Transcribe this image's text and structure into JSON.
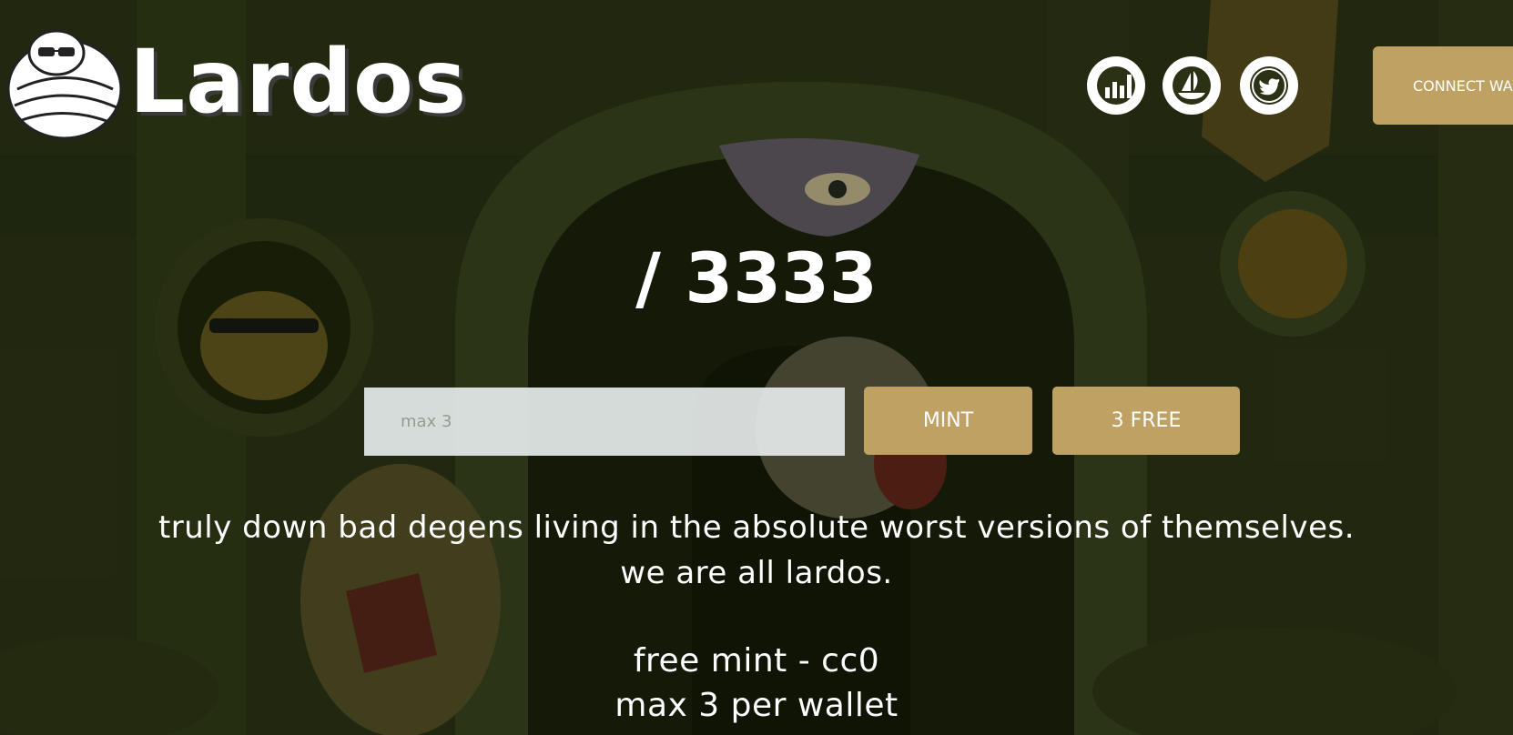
{
  "header": {
    "brand": "Lardos",
    "connect_label": "CONNECT WALLET",
    "social": [
      {
        "name": "Chart"
      },
      {
        "name": "OpenSea"
      },
      {
        "name": "Twitter"
      }
    ]
  },
  "mint": {
    "supply_text": "/ 3333",
    "quantity_placeholder": "max 3",
    "mint_label": "MINT",
    "free_label": "3 FREE"
  },
  "description": {
    "line1": "truly down bad degens living in the absolute worst versions of themselves.",
    "line2": "we are all lardos.",
    "line3": "free mint - cc0",
    "line4": "max 3 per wallet"
  },
  "colors": {
    "accent": "#bfa263",
    "background": "#232a12",
    "text": "#ffffff"
  }
}
